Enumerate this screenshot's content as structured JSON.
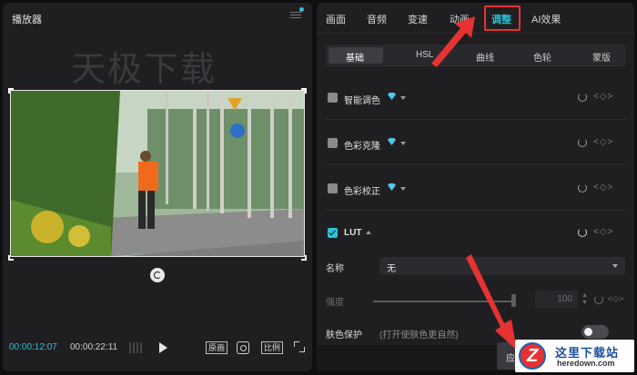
{
  "player": {
    "title": "播放器",
    "watermark": "天极下载",
    "current_time": "00:00:12:07",
    "total_time": "00:00:22:11",
    "original_label": "原画",
    "ratio_label": "比例"
  },
  "tabs": [
    "画面",
    "音频",
    "变速",
    "动画",
    "调整",
    "AI效果"
  ],
  "active_tab": "调整",
  "subtabs": [
    "基础",
    "HSL",
    "曲线",
    "色轮",
    "蒙版"
  ],
  "active_subtab": "基础",
  "sections": [
    {
      "label": "智能调色",
      "checked": false,
      "premium": true
    },
    {
      "label": "色彩克隆",
      "checked": false,
      "premium": true
    },
    {
      "label": "色彩校正",
      "checked": false,
      "premium": true
    },
    {
      "label": "LUT",
      "checked": true,
      "premium": false
    }
  ],
  "lut": {
    "name_label": "名称",
    "name_value": "无",
    "strength_label": "强度",
    "strength_value": "100",
    "skin_label": "肤色保护",
    "skin_hint": "(打开使肤色更自然)",
    "skin_enabled": false
  },
  "apply_label": "应",
  "badge": {
    "name": "这里下载站",
    "url": "heredown.com",
    "logo_letter": "Z"
  },
  "colors": {
    "accent": "#2bc3d6",
    "highlight": "#e63232"
  }
}
